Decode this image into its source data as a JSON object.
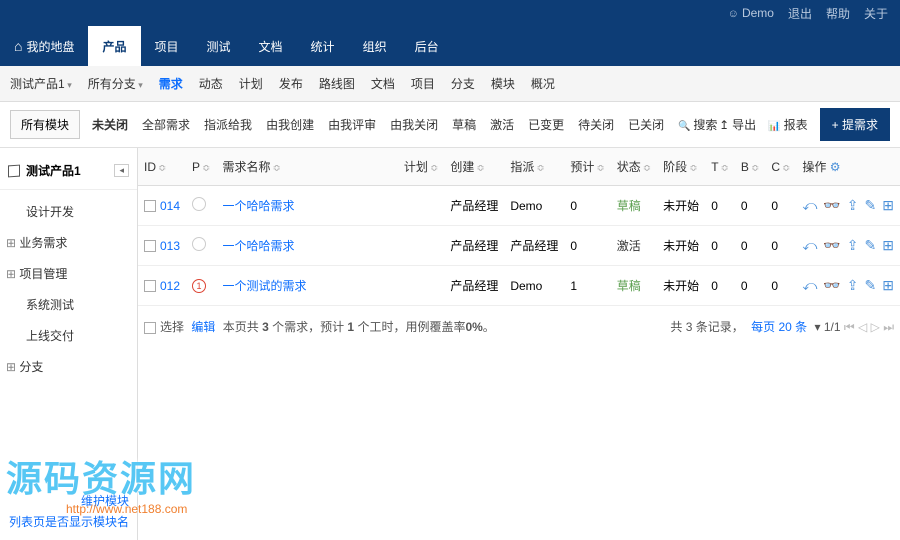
{
  "topbar": {
    "user": "Demo",
    "logout": "退出",
    "help": "帮助",
    "about": "关于"
  },
  "mainnav": [
    {
      "key": "home",
      "label": "我的地盘",
      "home": true
    },
    {
      "key": "product",
      "label": "产品",
      "active": true
    },
    {
      "key": "project",
      "label": "项目"
    },
    {
      "key": "test",
      "label": "测试"
    },
    {
      "key": "doc",
      "label": "文档"
    },
    {
      "key": "stat",
      "label": "统计"
    },
    {
      "key": "org",
      "label": "组织"
    },
    {
      "key": "admin",
      "label": "后台"
    }
  ],
  "subnav": {
    "product": "测试产品1",
    "branch": "所有分支",
    "items": [
      {
        "label": "需求",
        "active": true
      },
      {
        "label": "动态"
      },
      {
        "label": "计划"
      },
      {
        "label": "发布"
      },
      {
        "label": "路线图"
      },
      {
        "label": "文档"
      },
      {
        "label": "项目"
      },
      {
        "label": "分支"
      },
      {
        "label": "模块"
      },
      {
        "label": "概况"
      }
    ]
  },
  "toolbar": {
    "allModules": "所有模块",
    "filters": [
      {
        "label": "未关闭",
        "active": true
      },
      {
        "label": "全部需求"
      },
      {
        "label": "指派给我"
      },
      {
        "label": "由我创建"
      },
      {
        "label": "由我评审"
      },
      {
        "label": "由我关闭"
      },
      {
        "label": "草稿"
      },
      {
        "label": "激活"
      },
      {
        "label": "已变更"
      },
      {
        "label": "待关闭"
      },
      {
        "label": "已关闭"
      },
      {
        "label": "搜索",
        "search": true
      }
    ],
    "export": "导出",
    "report": "报表",
    "create": "提需求"
  },
  "sidebar": {
    "title": "测试产品1",
    "tree": [
      {
        "label": "设计开发"
      },
      {
        "label": "业务需求",
        "exp": true
      },
      {
        "label": "项目管理",
        "exp": true
      },
      {
        "label": "系统测试"
      },
      {
        "label": "上线交付"
      },
      {
        "label": "分支",
        "exp": true
      }
    ],
    "manage": "维护模块",
    "toggle": "列表页是否显示模块名"
  },
  "columns": {
    "id": "ID",
    "p": "P",
    "name": "需求名称",
    "plan": "计划",
    "creator": "创建",
    "assign": "指派",
    "est": "预计",
    "status": "状态",
    "stage": "阶段",
    "t": "T",
    "b": "B",
    "c": "C",
    "ops": "操作"
  },
  "rows": [
    {
      "id": "014",
      "pri": "",
      "name": "一个哈哈需求",
      "plan": "",
      "creator": "产品经理",
      "assign": "Demo",
      "est": "0",
      "status": "草稿",
      "stClass": "st-draft",
      "stage": "未开始",
      "t": "0",
      "b": "0",
      "c": "0"
    },
    {
      "id": "013",
      "pri": "",
      "name": "一个哈哈需求",
      "plan": "",
      "creator": "产品经理",
      "assign": "产品经理",
      "est": "0",
      "status": "激活",
      "stClass": "st-active",
      "stage": "未开始",
      "t": "0",
      "b": "0",
      "c": "0"
    },
    {
      "id": "012",
      "pri": "1",
      "name": "一个测试的需求",
      "plan": "",
      "creator": "产品经理",
      "assign": "Demo",
      "est": "1",
      "status": "草稿",
      "stClass": "st-draft",
      "stage": "未开始",
      "t": "0",
      "b": "0",
      "c": "0"
    }
  ],
  "footer": {
    "select": "选择",
    "edit": "编辑",
    "summary_a": "本页共 ",
    "summary_b": " 个需求，预计 ",
    "summary_c": " 个工时，用例覆盖率",
    "count": "3",
    "hours": "1",
    "coverage": "0%",
    "total": "共 3 条记录，",
    "perpage": "每页 20 条",
    "page": "1/1"
  },
  "watermark": {
    "t1": "源码资源网",
    "t2": "http://www.net188.com"
  }
}
